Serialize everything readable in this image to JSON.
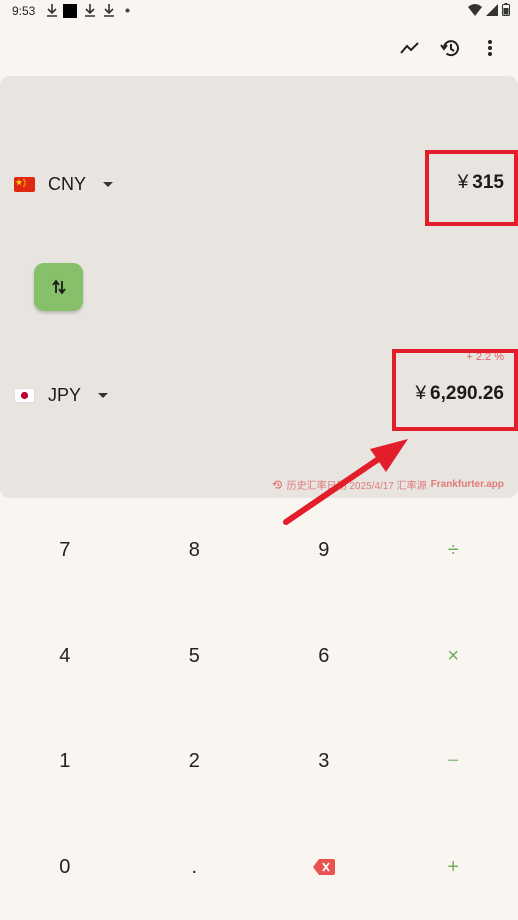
{
  "status_bar": {
    "time": "9:53",
    "icons": [
      "download-icon",
      "square-icon",
      "download-icon",
      "download-icon",
      "dot-icon"
    ],
    "right_icons": [
      "wifi-icon",
      "signal-icon",
      "battery-icon"
    ]
  },
  "toolbar": {
    "icons": [
      "trend-chart-icon",
      "history-icon",
      "more-vert-icon"
    ]
  },
  "converter": {
    "from": {
      "code": "CNY",
      "flag": "cn-flag-icon",
      "symbol": "¥",
      "amount": "315"
    },
    "to": {
      "code": "JPY",
      "flag": "jp-flag-icon",
      "symbol": "¥",
      "amount": "6,290.26"
    },
    "change": "+ 2.2 %",
    "rate_note": {
      "prefix": "历史汇率日期 2025/4/17 汇率源",
      "source": "Frankfurter.app"
    }
  },
  "keypad": {
    "rows": [
      [
        "7",
        "8",
        "9",
        "÷"
      ],
      [
        "4",
        "5",
        "6",
        "×"
      ],
      [
        "1",
        "2",
        "3",
        "−"
      ],
      [
        "0",
        ".",
        "backspace",
        "+"
      ]
    ]
  },
  "colors": {
    "background": "#f9f6f2",
    "card": "#e8e4e0",
    "accent_green": "#86c06a",
    "operator_green": "#6eaf5b",
    "highlight_red": "#e31d2a"
  }
}
